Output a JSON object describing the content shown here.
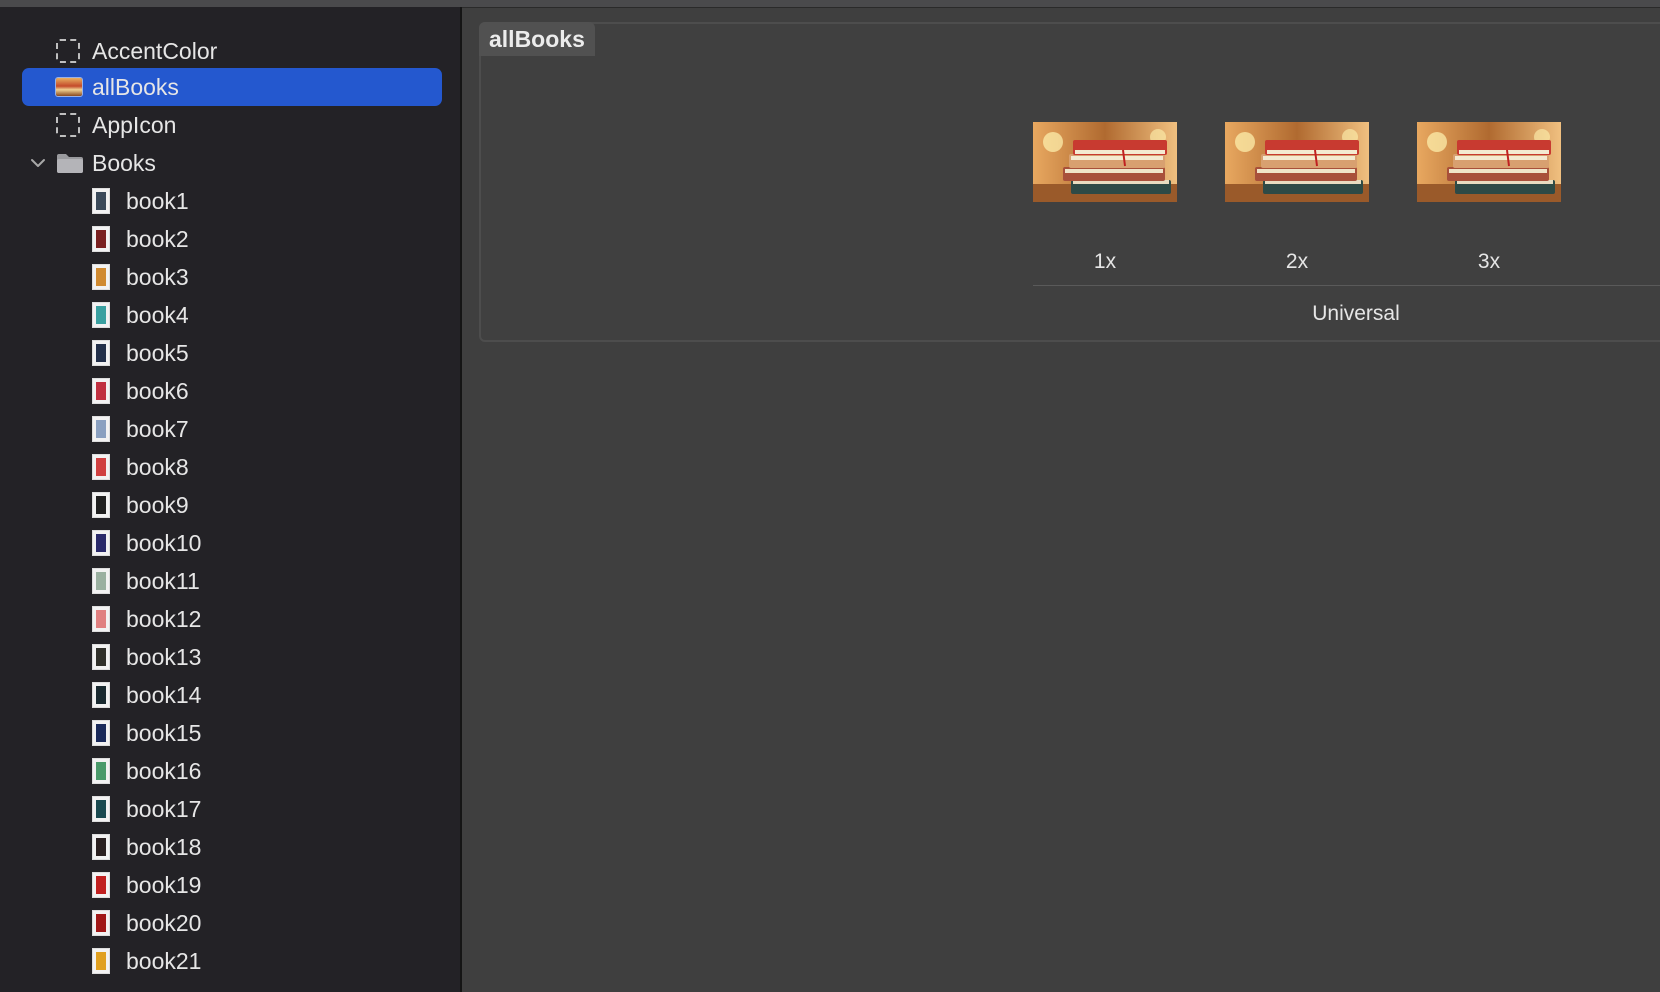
{
  "sidebar": {
    "items": [
      {
        "label": "AccentColor",
        "icon": "color-set-icon",
        "selected": false
      },
      {
        "label": "allBooks",
        "icon": "image-set-icon",
        "selected": true
      },
      {
        "label": "AppIcon",
        "icon": "app-icon-set-icon",
        "selected": false
      },
      {
        "label": "Books",
        "icon": "folder-icon",
        "expanded": true
      }
    ],
    "books": [
      {
        "label": "book1",
        "color": "#3b4a5a"
      },
      {
        "label": "book2",
        "color": "#7a2020"
      },
      {
        "label": "book3",
        "color": "#d08a30"
      },
      {
        "label": "book4",
        "color": "#3aa0a0"
      },
      {
        "label": "book5",
        "color": "#23304a"
      },
      {
        "label": "book6",
        "color": "#c03040"
      },
      {
        "label": "book7",
        "color": "#8aa0c0"
      },
      {
        "label": "book8",
        "color": "#d04040"
      },
      {
        "label": "book9",
        "color": "#202020"
      },
      {
        "label": "book10",
        "color": "#2a2a6a"
      },
      {
        "label": "book11",
        "color": "#9ab0a0"
      },
      {
        "label": "book12",
        "color": "#e08080"
      },
      {
        "label": "book13",
        "color": "#30302a"
      },
      {
        "label": "book14",
        "color": "#1a2a30"
      },
      {
        "label": "book15",
        "color": "#1a2a5a"
      },
      {
        "label": "book16",
        "color": "#4a9a6a"
      },
      {
        "label": "book17",
        "color": "#1a4a50"
      },
      {
        "label": "book18",
        "color": "#2a2020"
      },
      {
        "label": "book19",
        "color": "#c02020"
      },
      {
        "label": "book20",
        "color": "#a01818"
      },
      {
        "label": "book21",
        "color": "#e0a020"
      }
    ]
  },
  "editor": {
    "title": "allBooks",
    "scales": [
      "1x",
      "2x",
      "3x"
    ],
    "device": "Universal"
  },
  "colors": {
    "selection": "#2458cf",
    "sidebar_bg": "#232226",
    "editor_bg": "#3f3f3f"
  }
}
